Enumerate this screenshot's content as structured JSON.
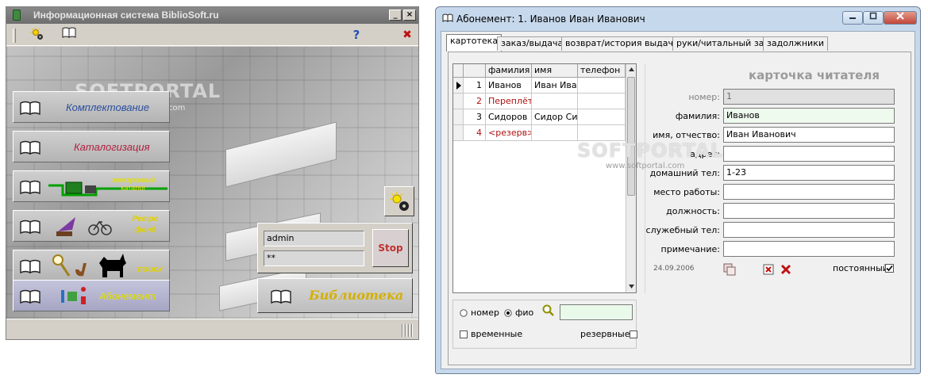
{
  "main_window": {
    "title": "Информационная система BiblioSoft.ru",
    "icons": {
      "app": "book-icon",
      "settings": "gear-sun-icon",
      "catalog": "book-icon",
      "help": "question-icon",
      "close": "close-x-icon"
    },
    "controls": {
      "minimize": "_",
      "close": "×"
    },
    "help_glyph": "?",
    "exit_glyph": "✖",
    "menu": [
      {
        "label": "Комплектование",
        "color": "#2a4fa0"
      },
      {
        "label": "Каталогизация",
        "color": "#b02040"
      },
      {
        "label": "электронный каталог",
        "color": "#e0e000"
      },
      {
        "label": "Ретро фонд",
        "color": "#e0d000"
      },
      {
        "label": "поиск",
        "color": "#e0d000"
      },
      {
        "label": "Абонемент",
        "color": "#e0e000"
      }
    ],
    "login": {
      "user": "admin",
      "password": "**"
    },
    "stop_label": "Stop",
    "library_label": "Библиотека"
  },
  "watermark": {
    "brand": "SOFTPORTAL",
    "url": "www.softportal.com"
  },
  "reader_window": {
    "title": "Абонемент: 1.   Иванов Иван Иванович",
    "tabs": [
      "картотека",
      "заказ/выдача",
      "возврат/история выдачи",
      "руки/читальный зал",
      "задолжники"
    ],
    "active_tab": 0,
    "grid": {
      "columns": [
        "фамилия",
        "имя",
        "телефон"
      ],
      "rows": [
        {
          "num": "1",
          "surname": "Иванов",
          "name": "Иван Иван",
          "phone": "",
          "current": true,
          "reserved": false
        },
        {
          "num": "2",
          "surname": "Переплёт",
          "name": "",
          "phone": "",
          "current": false,
          "reserved": true
        },
        {
          "num": "3",
          "surname": "Сидоров",
          "name": "Сидор Сид",
          "phone": "",
          "current": false,
          "reserved": false
        },
        {
          "num": "4",
          "surname": "<резерв>",
          "name": "",
          "phone": "",
          "current": false,
          "reserved": true
        }
      ]
    },
    "search": {
      "option_number": "номер",
      "option_fio": "фио",
      "selected": "фио",
      "value": "",
      "temporary_label": "временные",
      "reserved_label": "резервные"
    },
    "card": {
      "heading": "карточка читателя",
      "fields": [
        {
          "label": "номер:",
          "value": "1",
          "readonly": true
        },
        {
          "label": "фамилия:",
          "value": "Иванов",
          "highlight": true
        },
        {
          "label": "имя, отчество:",
          "value": "Иван Иванович"
        },
        {
          "label": "адрес:",
          "value": ""
        },
        {
          "label": "домашний тел:",
          "value": "1-23"
        },
        {
          "label": "место работы:",
          "value": ""
        },
        {
          "label": "должность:",
          "value": ""
        },
        {
          "label": "служебный тел:",
          "value": ""
        },
        {
          "label": "примечание:",
          "value": ""
        }
      ],
      "date": "24.09.2006",
      "permanent_label": "постоянный",
      "permanent_checked": true
    }
  }
}
